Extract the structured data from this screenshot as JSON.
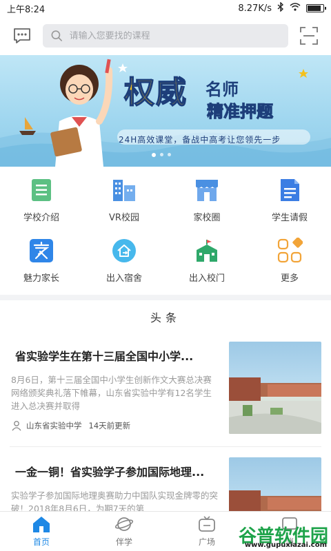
{
  "status_bar": {
    "time": "上午8:24",
    "network_speed": "8.27K/s",
    "battery_level": 0.9
  },
  "search": {
    "placeholder": "请输入您要找的课程"
  },
  "banner": {
    "title": "权威",
    "subtitle_1": "名师",
    "subtitle_2": "精准押题",
    "tagline": "24H高效课堂，备战中高考让您领先一步",
    "dot_count": 3,
    "active_dot": 0
  },
  "grid": [
    {
      "label": "学校介绍",
      "icon": "document-list-icon",
      "color": "#5cc083"
    },
    {
      "label": "VR校园",
      "icon": "building-icon",
      "color": "#4a90e2"
    },
    {
      "label": "家校圈",
      "icon": "storefront-icon",
      "color": "#4a90e2"
    },
    {
      "label": "学生请假",
      "icon": "leave-form-icon",
      "color": "#3b7de3"
    },
    {
      "label": "魅力家长",
      "icon": "family-icon",
      "color": "#2f86e8"
    },
    {
      "label": "出入宿舍",
      "icon": "home-exit-icon",
      "color": "#47b8ec"
    },
    {
      "label": "出入校门",
      "icon": "school-gate-icon",
      "color": "#2fa86a"
    },
    {
      "label": "更多",
      "icon": "more-grid-icon",
      "color": "#f2a438"
    }
  ],
  "headlines_title": "头条",
  "news": [
    {
      "title": "省实验学生在第十三届全国中小学...",
      "desc": "8月6日，第十三届全国中小学生创新作文大赛总决赛网络颁奖典礼落下帷幕，山东省实验中学有12名学生进入总决赛并取得",
      "source": "山东省实验中学",
      "time": "14天前更新"
    },
    {
      "title": "一金一铜！省实验学子参加国际地理...",
      "desc": "实验学子参加国际地理奥赛助力中国队实现金牌零的突破！2018年8月6日，为期7天的第"
    }
  ],
  "tabs": [
    {
      "label": "首页",
      "icon": "home-icon"
    },
    {
      "label": "伴学",
      "icon": "planet-icon"
    },
    {
      "label": "广场",
      "icon": "tv-icon"
    },
    {
      "label": "消",
      "icon": "message-icon"
    }
  ],
  "watermark": {
    "text": "谷普软件园",
    "url": "www.gupuxiazai.com"
  },
  "colors": {
    "accent": "#1e88e5",
    "banner_yellow": "#f4c11d",
    "banner_navy": "#1d3e7a"
  }
}
